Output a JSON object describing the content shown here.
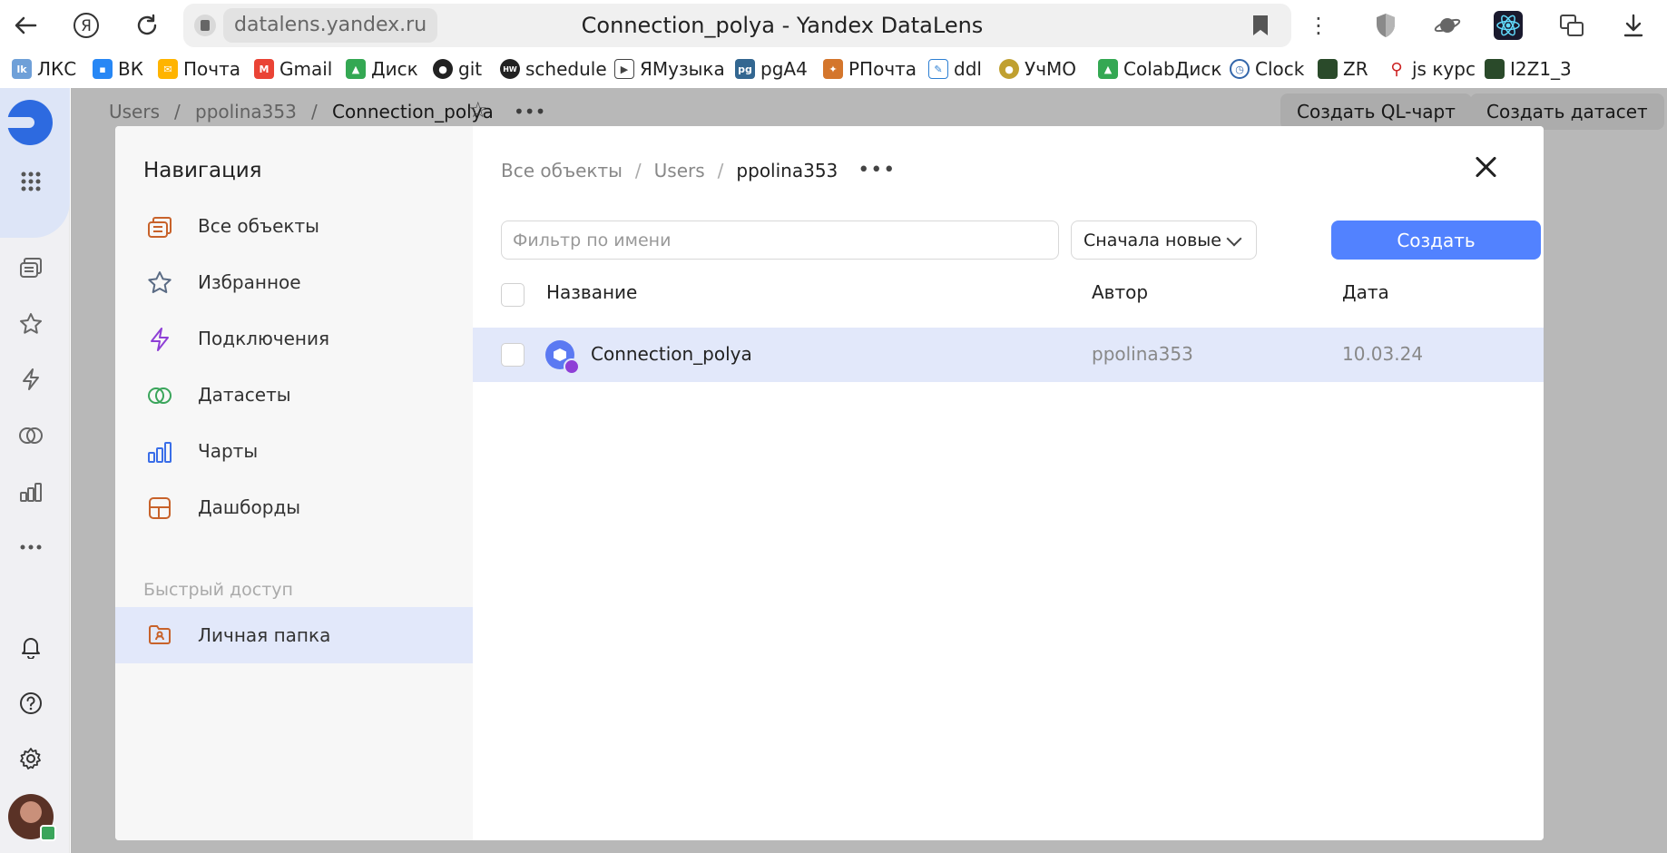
{
  "browser": {
    "domain": "datalens.yandex.ru",
    "title": "Connection_polya - Yandex DataLens"
  },
  "bookmarks": [
    {
      "label": "ЛКС",
      "icon": "lks-icon",
      "color": "#6fa0d8"
    },
    {
      "label": "ВК",
      "icon": "vk-icon",
      "color": "#2787f5"
    },
    {
      "label": "Почта",
      "icon": "mail-icon",
      "color": "#ffb400"
    },
    {
      "label": "Gmail",
      "icon": "gmail-icon",
      "color": "#ea4335"
    },
    {
      "label": "Диск",
      "icon": "drive-icon",
      "color": "#34a853"
    },
    {
      "label": "git",
      "icon": "github-icon",
      "color": "#222222"
    },
    {
      "label": "schedule",
      "icon": "schedule-icon",
      "color": "#222222"
    },
    {
      "label": "ЯМузыка",
      "icon": "music-icon",
      "color": "#444444"
    },
    {
      "label": "pgA4",
      "icon": "pg-icon",
      "color": "#336791"
    },
    {
      "label": "РПочта",
      "icon": "post-icon",
      "color": "#d4762c"
    },
    {
      "label": "ddl",
      "icon": "ddl-icon",
      "color": "#2d7fd3"
    },
    {
      "label": "УчМО",
      "icon": "uchmo-icon",
      "color": "#c0a030"
    },
    {
      "label": "ColabДиск",
      "icon": "drive-icon",
      "color": "#34a853"
    },
    {
      "label": "Clock",
      "icon": "clock-icon",
      "color": "#3366aa"
    },
    {
      "label": "ZR",
      "icon": "zr-icon",
      "color": "#2a4a2a"
    },
    {
      "label": "js курс",
      "icon": "js-icon",
      "color": "#cc2222"
    },
    {
      "label": "I2Z1_3",
      "icon": "i2z-icon",
      "color": "#2a4a2a"
    }
  ],
  "background": {
    "breadcrumbs": [
      "Users",
      "ppolina353",
      "Connection_polya"
    ],
    "buttons": [
      "Создать QL-чарт",
      "Создать датасет"
    ]
  },
  "nav": {
    "title": "Навигация",
    "items": [
      {
        "label": "Все объекты",
        "icon": "all-objects-icon"
      },
      {
        "label": "Избранное",
        "icon": "star-icon"
      },
      {
        "label": "Подключения",
        "icon": "lightning-icon"
      },
      {
        "label": "Датасеты",
        "icon": "datasets-icon"
      },
      {
        "label": "Чарты",
        "icon": "chart-icon"
      },
      {
        "label": "Дашборды",
        "icon": "dashboard-icon"
      }
    ],
    "section": "Быстрый доступ",
    "quick": {
      "label": "Личная папка",
      "icon": "personal-folder-icon"
    }
  },
  "content": {
    "breadcrumbs": [
      "Все объекты",
      "Users",
      "ppolina353"
    ],
    "filter_placeholder": "Фильтр по имени",
    "sort_label": "Сначала новые",
    "create_label": "Создать",
    "columns": {
      "name": "Название",
      "author": "Автор",
      "date": "Дата"
    },
    "rows": [
      {
        "name": "Connection_polya",
        "author": "ppolina353",
        "date": "10.03.24"
      }
    ]
  },
  "colors": {
    "accent": "#5282ff",
    "selection": "#e2e8fa",
    "icon_orange": "#c8622a",
    "icon_purple": "#8e3fd6",
    "icon_green": "#3aa55b",
    "icon_blue": "#3a6ee8"
  }
}
